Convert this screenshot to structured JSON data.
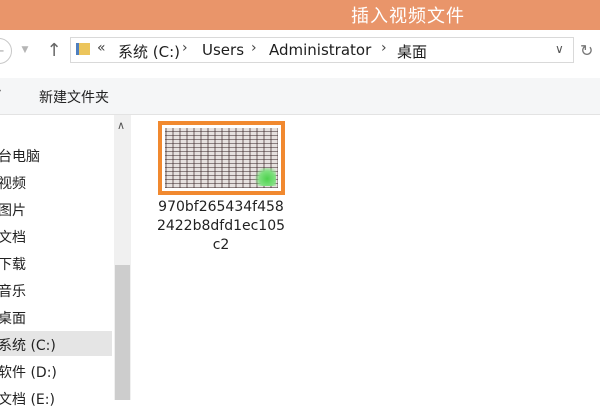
{
  "window": {
    "title": "插入视频文件"
  },
  "nav": {
    "back_glyph": "←",
    "dropdown_glyph": "▼",
    "up_glyph": "↑",
    "refresh_glyph": "↻"
  },
  "address": {
    "overflow": "«",
    "crumbs": [
      "系统 (C:)",
      "Users",
      "Administrator",
      "桌面"
    ],
    "separator": "›",
    "dropdown_glyph": "∨"
  },
  "commandbar": {
    "caret": "▾",
    "new_folder_label": "新建文件夹"
  },
  "navpane": {
    "items": [
      "台电脑",
      "视频",
      "图片",
      "文档",
      "下载",
      "音乐",
      "桌面",
      "系统 (C:)",
      "软件 (D:)",
      "文档 (E:)"
    ],
    "selected_index": 7
  },
  "scrollbar": {
    "up_glyph": "∧"
  },
  "files": [
    {
      "name": "970bf265434f4582422b8dfd1ec105c2",
      "icon": "image-thumbnail-icon",
      "selected": true
    }
  ],
  "colors": {
    "titlebar": "#e9956a",
    "selection_border": "#f1892f",
    "folder_icon": "#ecc55c"
  }
}
